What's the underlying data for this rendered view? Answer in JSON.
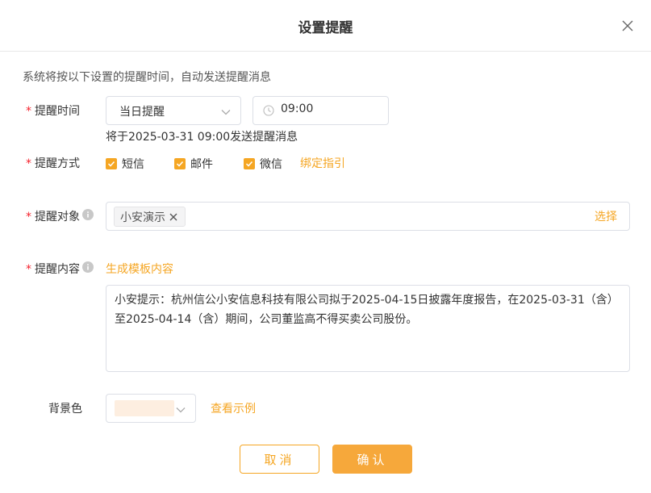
{
  "dialog": {
    "title": "设置提醒",
    "description": "系统将按以下设置的提醒时间，自动发送提醒消息"
  },
  "remind_time": {
    "label": "提醒时间",
    "option_selected": "当日提醒",
    "time_value": "09:00",
    "hint": "将于2025-03-31 09:00发送提醒消息"
  },
  "remind_method": {
    "label": "提醒方式",
    "options": [
      {
        "label": "短信",
        "checked": true
      },
      {
        "label": "邮件",
        "checked": true
      },
      {
        "label": "微信",
        "checked": true
      }
    ],
    "bind_link": "绑定指引"
  },
  "remind_target": {
    "label": "提醒对象",
    "tags": [
      "小安演示"
    ],
    "select_link": "选择"
  },
  "remind_content": {
    "label": "提醒内容",
    "template_link": "生成模板内容",
    "text": "小安提示：杭州信公小安信息科技有限公司拟于2025-04-15日披露年度报告，在2025-03-31（含）至2025-04-14（含）期间，公司董监高不得买卖公司股份。"
  },
  "background": {
    "label": "背景色",
    "color": "#fdeee0",
    "example_link": "查看示例"
  },
  "buttons": {
    "cancel": "取消",
    "confirm": "确认"
  },
  "colors": {
    "accent": "#f5a623",
    "required": "#f5222d"
  },
  "icons": {
    "close": "close-icon",
    "chevron": "chevron-down-icon",
    "clock": "clock-icon",
    "info": "info-icon",
    "check": "check-icon"
  }
}
